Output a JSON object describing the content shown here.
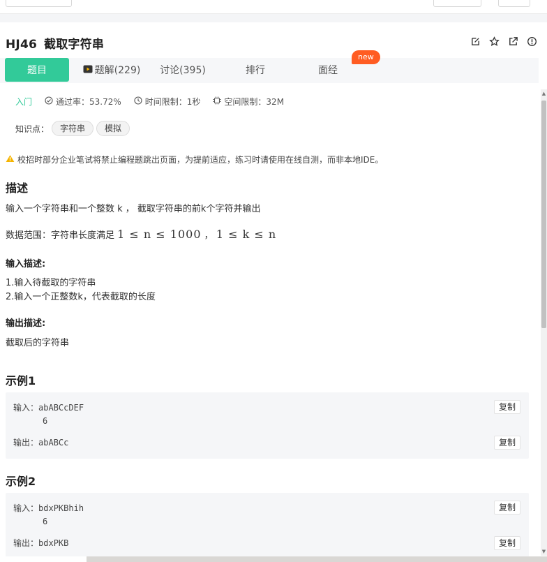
{
  "problem": {
    "code": "HJ46",
    "title": "截取字符串"
  },
  "tabs": [
    {
      "label": "题目"
    },
    {
      "label": "题解(229)"
    },
    {
      "label": "讨论(395)"
    },
    {
      "label": "排行"
    },
    {
      "label": "面经"
    }
  ],
  "new_badge": "new",
  "meta": {
    "level": "入门",
    "pass_rate": "通过率：53.72%",
    "time_limit": "时间限制：1秒",
    "space_limit": "空间限制：32M"
  },
  "tags": {
    "label": "知识点：",
    "items": [
      "字符串",
      "模拟"
    ]
  },
  "warning": "校招时部分企业笔试将禁止编程题跳出页面，为提前适应，练习时请使用在线自测，而非本地IDE。",
  "description": {
    "heading": "描述",
    "text": "输入一个字符串和一个整数 k ， 截取字符串的前k个字符并输出",
    "range_label": "数据范围：字符串长度满足",
    "range_math1": "1 ≤ n ≤ 1000",
    "range_sep": "，",
    "range_math2": "1 ≤ k ≤ n"
  },
  "input_desc": {
    "heading": "输入描述:",
    "lines": [
      "1.输入待截取的字符串",
      "2.输入一个正整数k，代表截取的长度"
    ]
  },
  "output_desc": {
    "heading": "输出描述:",
    "text": "截取后的字符串"
  },
  "examples": [
    {
      "heading": "示例1",
      "input_label": "输入：",
      "input_lines": [
        "abABCcDEF",
        "6"
      ],
      "output_label": "输出：",
      "output": "abABCc",
      "copy": "复制"
    },
    {
      "heading": "示例2",
      "input_label": "输入：",
      "input_lines": [
        "bdxPKBhih",
        "6"
      ],
      "output_label": "输出：",
      "output": "bdxPKB",
      "copy": "复制"
    }
  ],
  "colors": {
    "accent": "#32ca99",
    "badge": "#ff5c22",
    "warning": "#f5b400"
  }
}
